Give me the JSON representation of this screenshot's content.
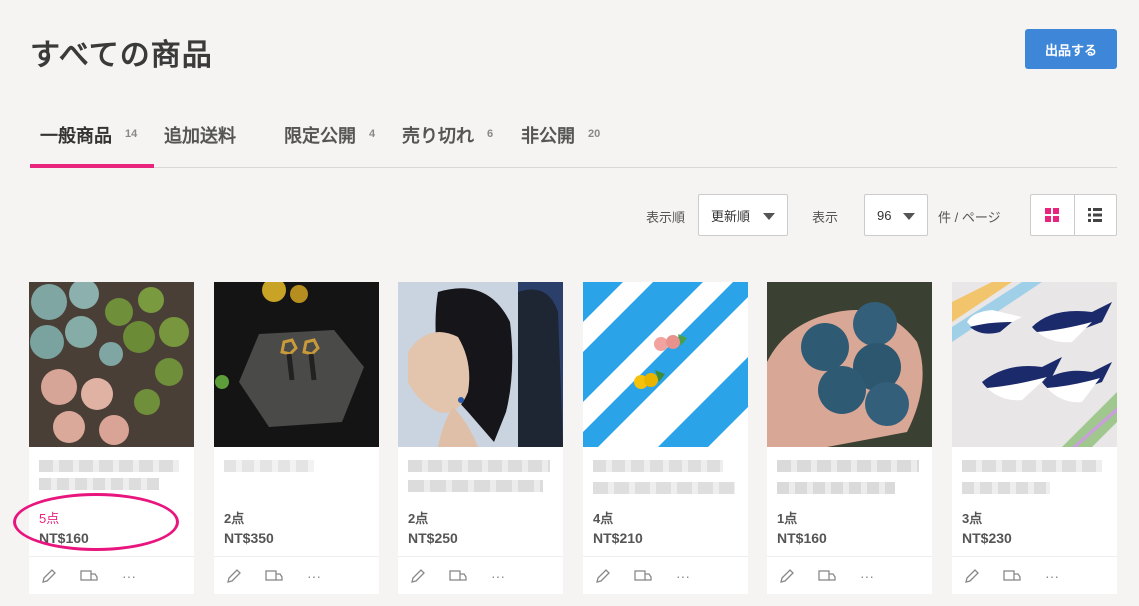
{
  "header": {
    "title": "すべての商品",
    "list_button": "出品する"
  },
  "tabs": [
    {
      "label": "一般商品",
      "count": "14"
    },
    {
      "label": "追加送料",
      "count": ""
    },
    {
      "label": "限定公開",
      "count": "4"
    },
    {
      "label": "売り切れ",
      "count": "6"
    },
    {
      "label": "非公開",
      "count": "20"
    }
  ],
  "controls": {
    "sort_label": "表示順",
    "sort_value": "更新順",
    "per_page_label": "表示",
    "per_page_value": "96",
    "per_page_suffix": "件 / ページ"
  },
  "products": [
    {
      "stock": "5点",
      "price": "NT$160"
    },
    {
      "stock": "2点",
      "price": "NT$350"
    },
    {
      "stock": "2点",
      "price": "NT$250"
    },
    {
      "stock": "4点",
      "price": "NT$210"
    },
    {
      "stock": "1点",
      "price": "NT$160"
    },
    {
      "stock": "3点",
      "price": "NT$230"
    }
  ],
  "footer_icons": [
    "pencil-icon",
    "shipping-icon",
    "more-icon"
  ],
  "more_glyph": "···",
  "colors": {
    "accent": "#e8247f",
    "primary": "#3e86d8",
    "background": "#f5f4f2"
  }
}
